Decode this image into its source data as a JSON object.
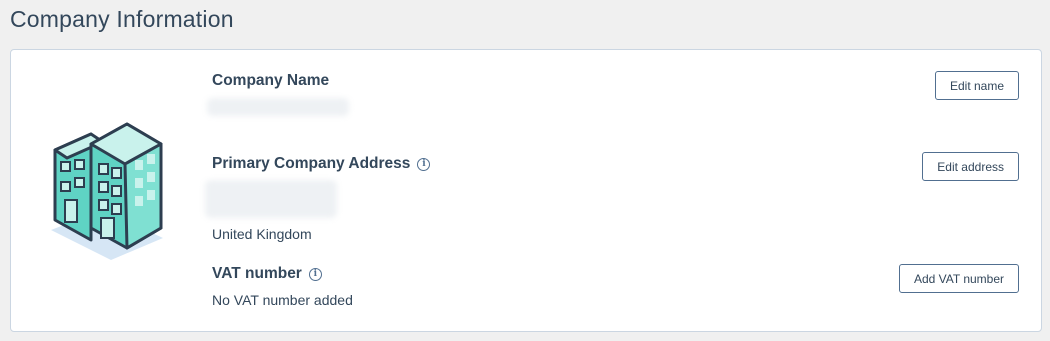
{
  "page": {
    "title": "Company Information"
  },
  "company_name": {
    "title": "Company Name",
    "edit_label": "Edit name"
  },
  "address": {
    "title": "Primary Company Address",
    "country": "United Kingdom",
    "edit_label": "Edit address"
  },
  "vat": {
    "title": "VAT number",
    "value": "No VAT number added",
    "add_label": "Add VAT number"
  },
  "icons": {
    "info": "info-icon",
    "illustration": "office-building-icon"
  },
  "colors": {
    "text": "#33475b",
    "border": "#cbd6e2",
    "button_border": "#516f90",
    "building_teal": "#5fd3c4",
    "building_light": "#c9f2ec",
    "shadow": "#d6e6f5"
  }
}
